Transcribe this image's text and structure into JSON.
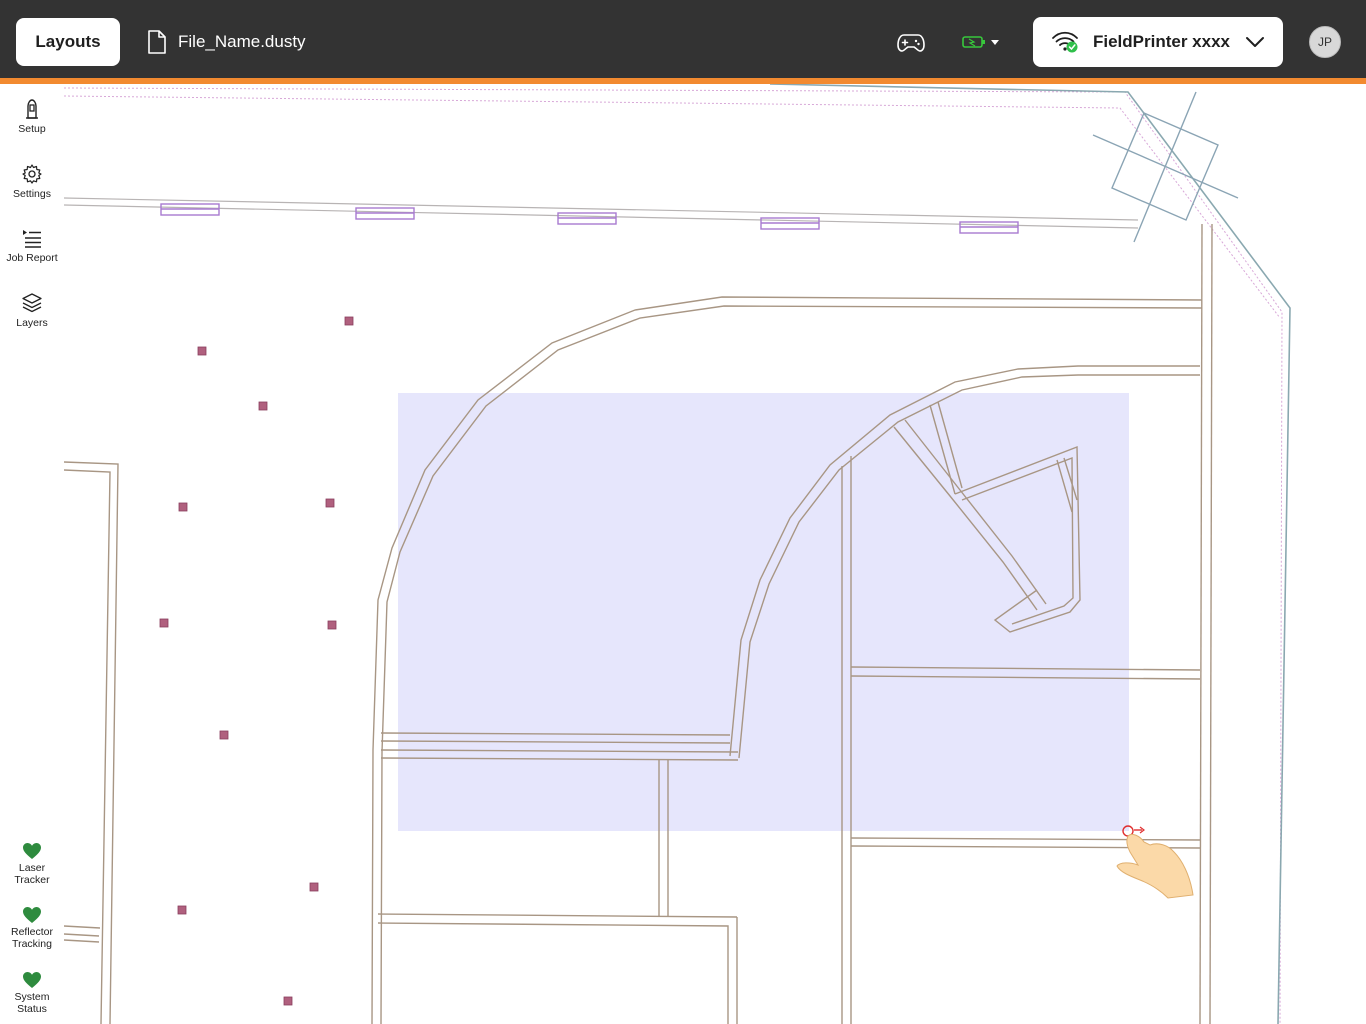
{
  "topbar": {
    "layouts_label": "Layouts",
    "file_name": "File_Name.dusty",
    "printer_name": "FieldPrinter xxxx",
    "avatar_initials": "JP"
  },
  "sidebar": {
    "items": [
      {
        "label": "Setup",
        "icon": "tracker-icon"
      },
      {
        "label": "Settings",
        "icon": "gear-icon"
      },
      {
        "label": "Job Report",
        "icon": "job-report-icon"
      },
      {
        "label": "Layers",
        "icon": "layers-icon"
      }
    ]
  },
  "status": {
    "items": [
      {
        "label_1": "Laser",
        "label_2": "Tracker",
        "icon": "heart-icon"
      },
      {
        "label_1": "Reflector",
        "label_2": "Tracking",
        "icon": "heart-icon"
      },
      {
        "label_1": "System",
        "label_2": "Status",
        "icon": "heart-icon"
      }
    ]
  },
  "colors": {
    "topbar": "#333333",
    "accent_orange": "#f28a30",
    "wall": "#a89684",
    "selection": "#e6e6fc",
    "status_ok": "#2e8b3e",
    "battery_ok": "#38c83c",
    "marker": "#b0607e"
  }
}
